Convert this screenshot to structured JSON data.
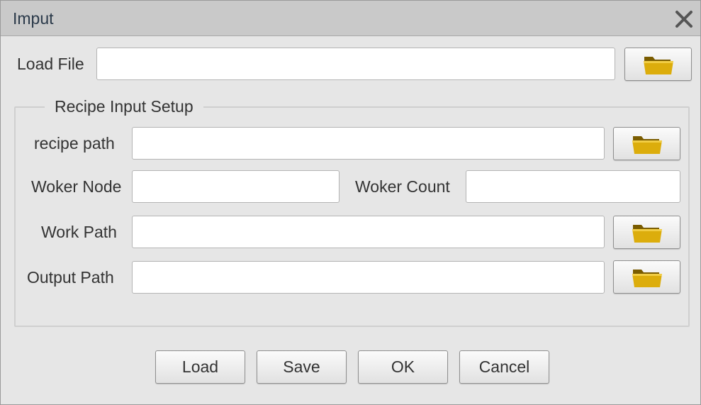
{
  "window": {
    "title": "Imput"
  },
  "load_file": {
    "label": "Load File",
    "value": ""
  },
  "recipe_group": {
    "legend": "Recipe Input Setup",
    "recipe_path": {
      "label": "recipe path",
      "value": ""
    },
    "worker_node": {
      "label": "Woker Node",
      "value": ""
    },
    "worker_count": {
      "label": "Woker Count",
      "value": ""
    },
    "work_path": {
      "label": "Work Path",
      "value": ""
    },
    "output_path": {
      "label": "Output Path",
      "value": ""
    }
  },
  "buttons": {
    "load": "Load",
    "save": "Save",
    "ok": "OK",
    "cancel": "Cancel"
  },
  "icons": {
    "close": "close-icon",
    "browse": "folder-icon"
  },
  "colors": {
    "folder": "#d9aa0a",
    "titlebar": "#c9c9c9",
    "background": "#e6e6e6"
  }
}
